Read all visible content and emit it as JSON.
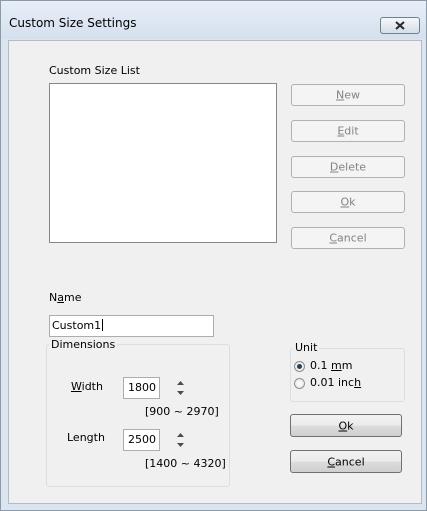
{
  "window": {
    "title": "Custom Size Settings"
  },
  "list": {
    "label": "Custom Size List",
    "items": []
  },
  "side_buttons": {
    "new": {
      "label": "New",
      "mnemonic": "N",
      "rest": "ew"
    },
    "edit": {
      "label": "Edit",
      "mnemonic": "E",
      "rest": "dit"
    },
    "delete": {
      "label": "Delete",
      "mnemonic": "D",
      "rest": "elete"
    },
    "ok": {
      "label": "Ok",
      "mnemonic": "O",
      "rest": "k"
    },
    "cancel": {
      "label": "Cancel",
      "mnemonic": "C",
      "rest": "ancel"
    }
  },
  "name_field": {
    "label_pre": "N",
    "label_mn": "a",
    "label_post": "me",
    "value": "Custom1"
  },
  "dimensions": {
    "title": "Dimensions",
    "width": {
      "label_mn": "W",
      "label_post": "idth",
      "value": "1800",
      "range": "[900 ~ 2970]"
    },
    "length": {
      "label": "Length",
      "value": "2500",
      "range": "[1400 ~ 4320]"
    }
  },
  "unit": {
    "title": "Unit",
    "options": [
      {
        "pre": "0.1 ",
        "mn": "m",
        "post": "m",
        "selected": true
      },
      {
        "pre": "0.01 inc",
        "mn": "h",
        "post": "",
        "selected": false
      }
    ]
  },
  "bottom_buttons": {
    "ok": {
      "mnemonic": "O",
      "rest": "k"
    },
    "cancel": {
      "mnemonic": "C",
      "rest": "ancel"
    }
  }
}
